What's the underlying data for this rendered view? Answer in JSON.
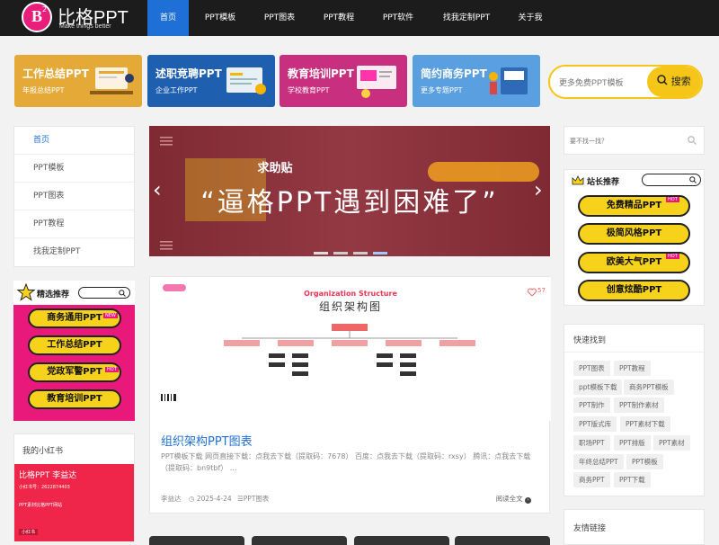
{
  "brand": {
    "name": "比格PPT",
    "slogan": "Make things better",
    "badge": "B",
    "badge_sup": "2"
  },
  "nav": {
    "items": [
      "首页",
      "PPT模板",
      "PPT图表",
      "PPT教程",
      "PPT软件",
      "找我定制PPT",
      "关于我"
    ]
  },
  "banners": [
    {
      "title": "工作总结PPT",
      "subtitle": "年报总结PPT",
      "color": "#e4a936"
    },
    {
      "title": "述职竞聘PPT",
      "subtitle": "企业工作PPT",
      "color": "#1e5fb0"
    },
    {
      "title": "教育培训PPT",
      "subtitle": "学校教育PPT",
      "color": "#c8307f"
    },
    {
      "title": "简约商务PPT",
      "subtitle": "更多专题PPT",
      "color": "#5aa0e0"
    }
  ],
  "search": {
    "placeholder": "更多免费PPT模板",
    "button": "搜索"
  },
  "sidebar_menu": [
    "首页",
    "PPT模板",
    "PPT图表",
    "PPT教程",
    "找我定制PPT"
  ],
  "featured": {
    "title": "精选推荐",
    "items": [
      "商务通用PPT",
      "工作总结PPT",
      "党政军警PPT",
      "教育培训PPT"
    ],
    "badges": [
      "NEW",
      "",
      "HOT",
      ""
    ]
  },
  "xiaohongshu": {
    "title": "我的小红书",
    "name": "比格PPT 李益达",
    "line1": "小红书号：2622874403",
    "line2": "PPT素材比格PPT网站",
    "tag": "小红书"
  },
  "slider": {
    "small_title": "求助贴",
    "main_text": "“逼格PPT遇到困难了”",
    "prev": "‹",
    "next": "›"
  },
  "post": {
    "thumb_title_en": "Organization Structure",
    "thumb_title_cn": "组织架构图",
    "likes": "57",
    "title": "组织架构PPT图表",
    "excerpt": "PPT模板下载 网页直接下载：点我去下载（提取码：7678） 百度：点我去下载（提取码：rxsy） 腾讯：点我去下载（提取码：bn9tbf） ...",
    "author": "李益达",
    "date": "2025-4-24",
    "category": "PPT图表",
    "readmore": "阅读全文"
  },
  "right_search": {
    "placeholder": "要不找一找？"
  },
  "station": {
    "title": "站长推荐",
    "items": [
      "免费精品PPT",
      "极简风格PPT",
      "欧美大气PPT",
      "创意炫酷PPT"
    ],
    "badges": [
      "HOT",
      "",
      "HOT",
      ""
    ]
  },
  "quick": {
    "title": "快速找到",
    "tags": [
      "PPT图表",
      "PPT教程",
      "ppt模板下载",
      "商务PPT模板",
      "PPT制作",
      "PPT制作素材",
      "PPT版式库",
      "PPT素材下载",
      "职场PPT",
      "PPT排版",
      "PPT素材",
      "年终总结PPT",
      "PPT模板",
      "商务PPT",
      "PPT下载"
    ]
  },
  "links": {
    "title": "友情链接"
  }
}
